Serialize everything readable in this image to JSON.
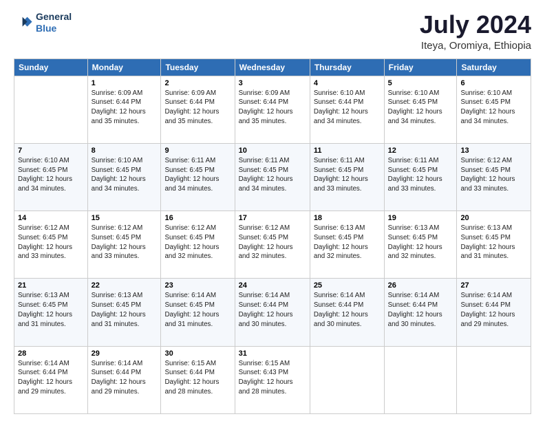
{
  "header": {
    "logo_line1": "General",
    "logo_line2": "Blue",
    "month_year": "July 2024",
    "location": "Iteya, Oromiya, Ethiopia"
  },
  "days_of_week": [
    "Sunday",
    "Monday",
    "Tuesday",
    "Wednesday",
    "Thursday",
    "Friday",
    "Saturday"
  ],
  "weeks": [
    [
      {
        "num": "",
        "info": ""
      },
      {
        "num": "1",
        "info": "Sunrise: 6:09 AM\nSunset: 6:44 PM\nDaylight: 12 hours\nand 35 minutes."
      },
      {
        "num": "2",
        "info": "Sunrise: 6:09 AM\nSunset: 6:44 PM\nDaylight: 12 hours\nand 35 minutes."
      },
      {
        "num": "3",
        "info": "Sunrise: 6:09 AM\nSunset: 6:44 PM\nDaylight: 12 hours\nand 35 minutes."
      },
      {
        "num": "4",
        "info": "Sunrise: 6:10 AM\nSunset: 6:44 PM\nDaylight: 12 hours\nand 34 minutes."
      },
      {
        "num": "5",
        "info": "Sunrise: 6:10 AM\nSunset: 6:45 PM\nDaylight: 12 hours\nand 34 minutes."
      },
      {
        "num": "6",
        "info": "Sunrise: 6:10 AM\nSunset: 6:45 PM\nDaylight: 12 hours\nand 34 minutes."
      }
    ],
    [
      {
        "num": "7",
        "info": "Sunrise: 6:10 AM\nSunset: 6:45 PM\nDaylight: 12 hours\nand 34 minutes."
      },
      {
        "num": "8",
        "info": "Sunrise: 6:10 AM\nSunset: 6:45 PM\nDaylight: 12 hours\nand 34 minutes."
      },
      {
        "num": "9",
        "info": "Sunrise: 6:11 AM\nSunset: 6:45 PM\nDaylight: 12 hours\nand 34 minutes."
      },
      {
        "num": "10",
        "info": "Sunrise: 6:11 AM\nSunset: 6:45 PM\nDaylight: 12 hours\nand 34 minutes."
      },
      {
        "num": "11",
        "info": "Sunrise: 6:11 AM\nSunset: 6:45 PM\nDaylight: 12 hours\nand 33 minutes."
      },
      {
        "num": "12",
        "info": "Sunrise: 6:11 AM\nSunset: 6:45 PM\nDaylight: 12 hours\nand 33 minutes."
      },
      {
        "num": "13",
        "info": "Sunrise: 6:12 AM\nSunset: 6:45 PM\nDaylight: 12 hours\nand 33 minutes."
      }
    ],
    [
      {
        "num": "14",
        "info": "Sunrise: 6:12 AM\nSunset: 6:45 PM\nDaylight: 12 hours\nand 33 minutes."
      },
      {
        "num": "15",
        "info": "Sunrise: 6:12 AM\nSunset: 6:45 PM\nDaylight: 12 hours\nand 33 minutes."
      },
      {
        "num": "16",
        "info": "Sunrise: 6:12 AM\nSunset: 6:45 PM\nDaylight: 12 hours\nand 32 minutes."
      },
      {
        "num": "17",
        "info": "Sunrise: 6:12 AM\nSunset: 6:45 PM\nDaylight: 12 hours\nand 32 minutes."
      },
      {
        "num": "18",
        "info": "Sunrise: 6:13 AM\nSunset: 6:45 PM\nDaylight: 12 hours\nand 32 minutes."
      },
      {
        "num": "19",
        "info": "Sunrise: 6:13 AM\nSunset: 6:45 PM\nDaylight: 12 hours\nand 32 minutes."
      },
      {
        "num": "20",
        "info": "Sunrise: 6:13 AM\nSunset: 6:45 PM\nDaylight: 12 hours\nand 31 minutes."
      }
    ],
    [
      {
        "num": "21",
        "info": "Sunrise: 6:13 AM\nSunset: 6:45 PM\nDaylight: 12 hours\nand 31 minutes."
      },
      {
        "num": "22",
        "info": "Sunrise: 6:13 AM\nSunset: 6:45 PM\nDaylight: 12 hours\nand 31 minutes."
      },
      {
        "num": "23",
        "info": "Sunrise: 6:14 AM\nSunset: 6:45 PM\nDaylight: 12 hours\nand 31 minutes."
      },
      {
        "num": "24",
        "info": "Sunrise: 6:14 AM\nSunset: 6:44 PM\nDaylight: 12 hours\nand 30 minutes."
      },
      {
        "num": "25",
        "info": "Sunrise: 6:14 AM\nSunset: 6:44 PM\nDaylight: 12 hours\nand 30 minutes."
      },
      {
        "num": "26",
        "info": "Sunrise: 6:14 AM\nSunset: 6:44 PM\nDaylight: 12 hours\nand 30 minutes."
      },
      {
        "num": "27",
        "info": "Sunrise: 6:14 AM\nSunset: 6:44 PM\nDaylight: 12 hours\nand 29 minutes."
      }
    ],
    [
      {
        "num": "28",
        "info": "Sunrise: 6:14 AM\nSunset: 6:44 PM\nDaylight: 12 hours\nand 29 minutes."
      },
      {
        "num": "29",
        "info": "Sunrise: 6:14 AM\nSunset: 6:44 PM\nDaylight: 12 hours\nand 29 minutes."
      },
      {
        "num": "30",
        "info": "Sunrise: 6:15 AM\nSunset: 6:44 PM\nDaylight: 12 hours\nand 28 minutes."
      },
      {
        "num": "31",
        "info": "Sunrise: 6:15 AM\nSunset: 6:43 PM\nDaylight: 12 hours\nand 28 minutes."
      },
      {
        "num": "",
        "info": ""
      },
      {
        "num": "",
        "info": ""
      },
      {
        "num": "",
        "info": ""
      }
    ]
  ]
}
